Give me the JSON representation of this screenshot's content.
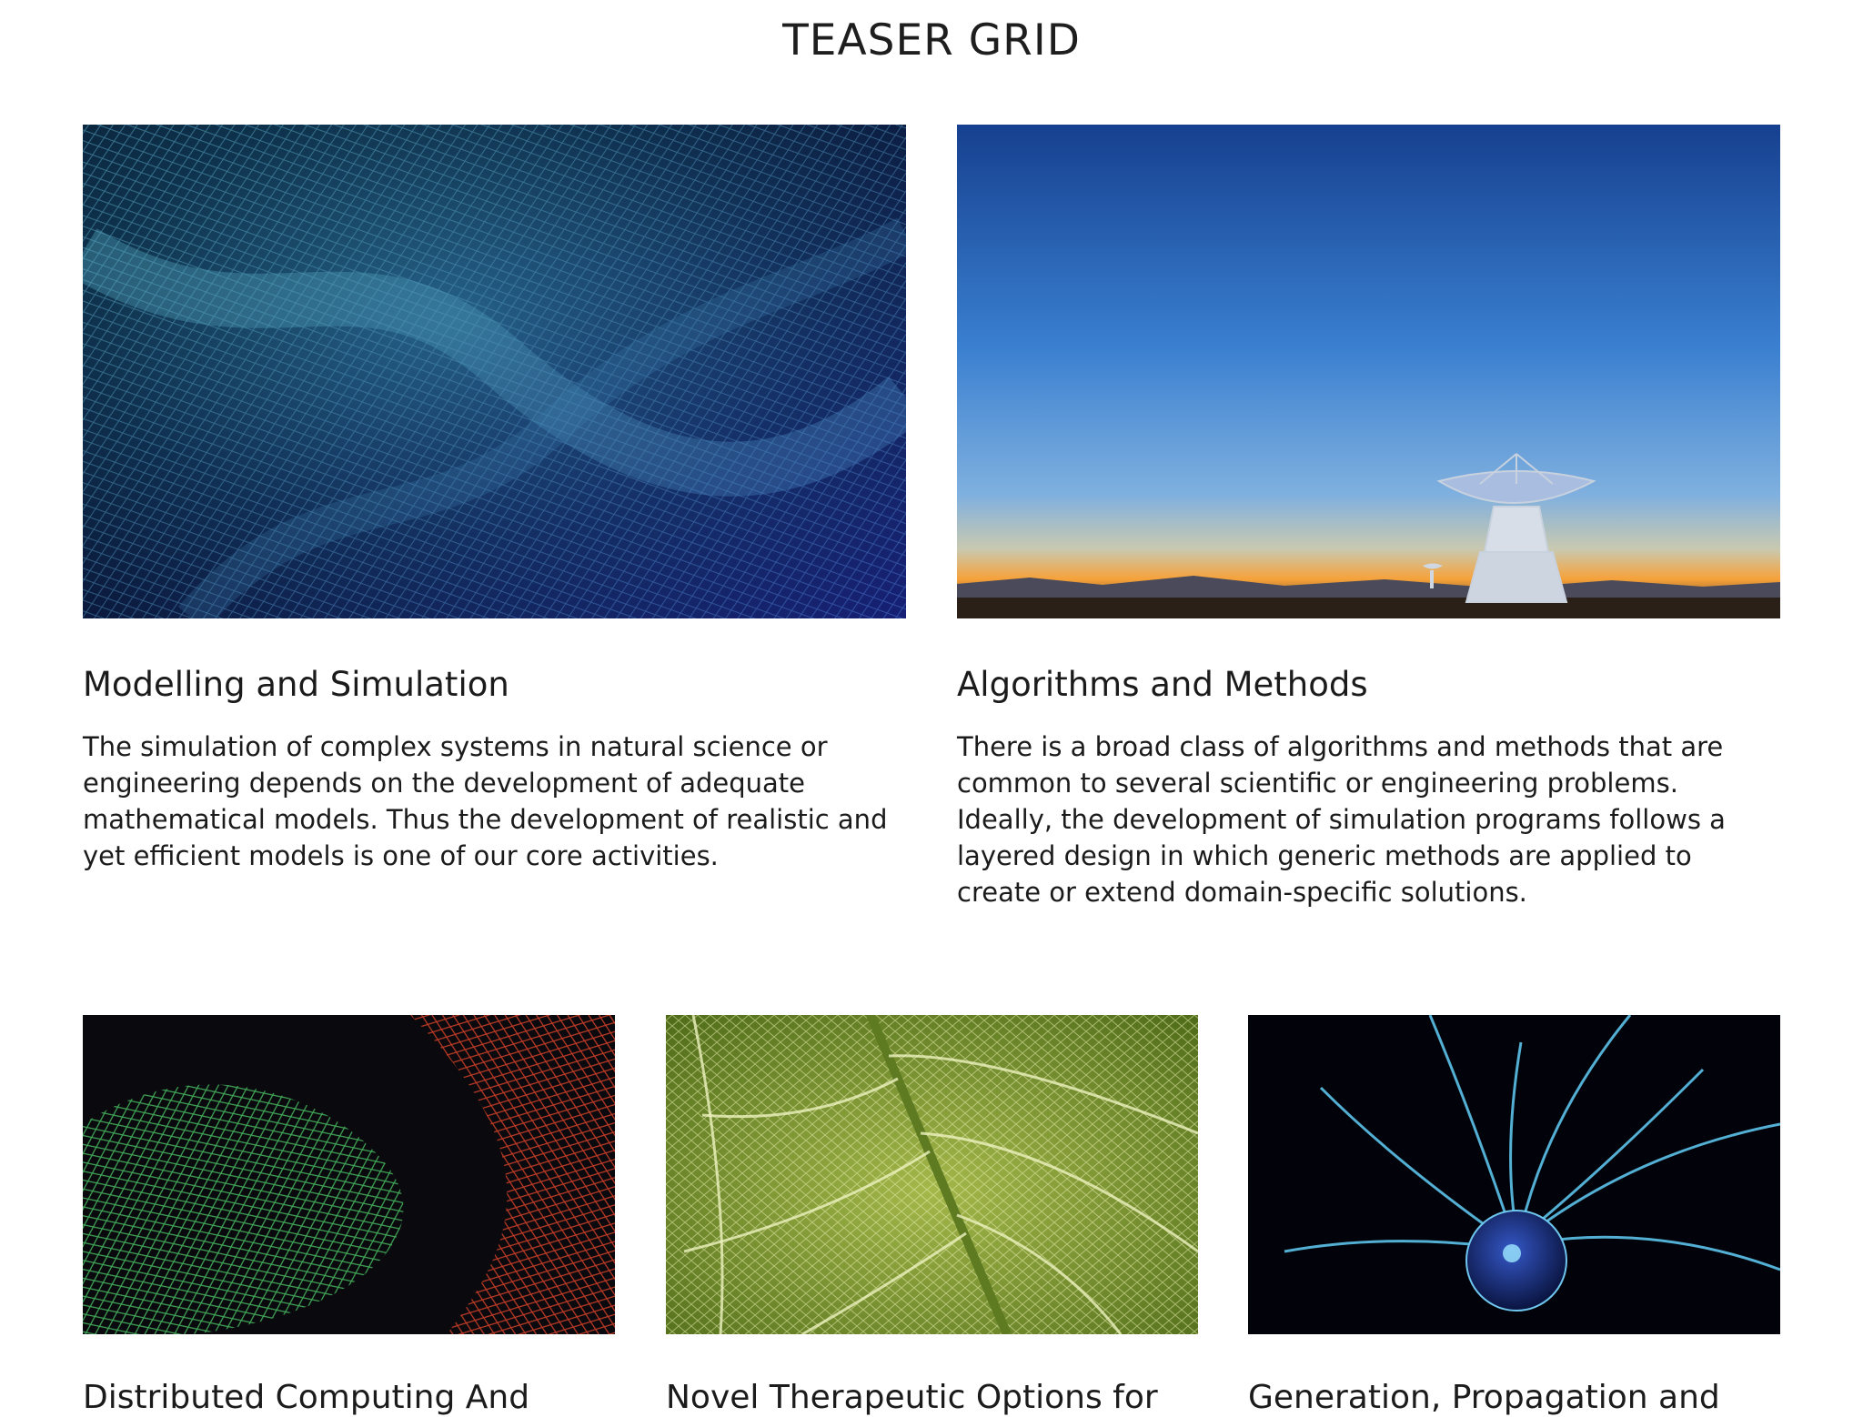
{
  "page": {
    "title": "TEASER GRID"
  },
  "teasers": [
    {
      "image_icon": "mesh-network-blue-image",
      "title": "Modelling and Simulation",
      "text": "The simulation of complex systems in natural science or engineering depends on the development of adequate mathematical models. Thus the development of realistic and yet efficient models is one of our core activities."
    },
    {
      "image_icon": "radio-telescope-image",
      "title": "Algorithms and Methods",
      "text": "There is a broad class of algorithms and methods that are common to several scientific or engineering problems. Ideally, the development of simulation programs follows a layered design in which generic methods are applied to create or extend domain-specific solutions."
    },
    {
      "image_icon": "mesh-network-green-red-image",
      "title": "Distributed Computing And"
    },
    {
      "image_icon": "leaf-veins-image",
      "title": "Novel Therapeutic Options for"
    },
    {
      "image_icon": "plasma-ball-image",
      "title": "Generation, Propagation and"
    }
  ],
  "colors": {
    "text": "#1b1b1b",
    "mesh_blue": "#1f5a7a",
    "sky_top": "#1c4fa3",
    "sunset": "#f6a23a",
    "leaf": "#7c9a2e",
    "plasma": "#4fb7e6"
  }
}
